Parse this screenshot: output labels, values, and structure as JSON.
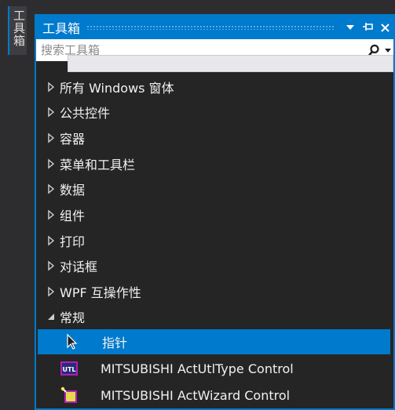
{
  "side_tab": {
    "label": "工具箱"
  },
  "panel": {
    "title": "工具箱",
    "search": {
      "placeholder": "搜索工具箱"
    }
  },
  "categories": [
    {
      "label": "所有 Windows 窗体",
      "expanded": false
    },
    {
      "label": "公共控件",
      "expanded": false
    },
    {
      "label": "容器",
      "expanded": false
    },
    {
      "label": "菜单和工具栏",
      "expanded": false
    },
    {
      "label": "数据",
      "expanded": false
    },
    {
      "label": "组件",
      "expanded": false
    },
    {
      "label": "打印",
      "expanded": false
    },
    {
      "label": "对话框",
      "expanded": false
    },
    {
      "label": "WPF 互操作性",
      "expanded": false
    },
    {
      "label": "常规",
      "expanded": true
    }
  ],
  "general_items": [
    {
      "label": "指针",
      "icon": "pointer-icon",
      "selected": true
    },
    {
      "label": "MITSUBISHI ActUtlType Control",
      "icon": "actutltype-control-icon",
      "selected": false
    },
    {
      "label": "MITSUBISHI ActWizard Control",
      "icon": "actwizard-control-icon",
      "selected": false
    }
  ],
  "colors": {
    "accent": "#007acc",
    "background": "#252526",
    "text": "#f1f1f1"
  }
}
